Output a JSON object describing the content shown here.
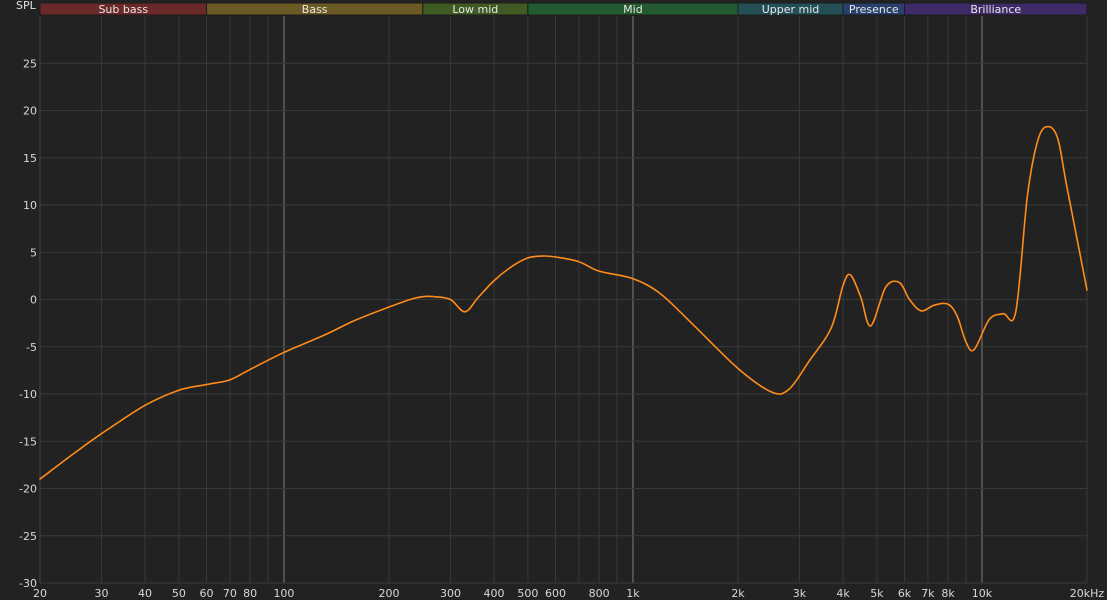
{
  "chart_data": {
    "type": "line",
    "ylabel": "SPL",
    "x_scale": "log",
    "xlim": [
      20,
      20000
    ],
    "ylim": [
      -30,
      30
    ],
    "grid": true,
    "x_ticks": [
      {
        "value": 20,
        "label": "20"
      },
      {
        "value": 30,
        "label": "30"
      },
      {
        "value": 40,
        "label": "40"
      },
      {
        "value": 50,
        "label": "50"
      },
      {
        "value": 60,
        "label": "60"
      },
      {
        "value": 70,
        "label": "70"
      },
      {
        "value": 80,
        "label": "80"
      },
      {
        "value": 100,
        "label": "100"
      },
      {
        "value": 200,
        "label": "200"
      },
      {
        "value": 300,
        "label": "300"
      },
      {
        "value": 400,
        "label": "400"
      },
      {
        "value": 500,
        "label": "500"
      },
      {
        "value": 600,
        "label": "600"
      },
      {
        "value": 800,
        "label": "800"
      },
      {
        "value": 1000,
        "label": "1k"
      },
      {
        "value": 2000,
        "label": "2k"
      },
      {
        "value": 3000,
        "label": "3k"
      },
      {
        "value": 4000,
        "label": "4k"
      },
      {
        "value": 5000,
        "label": "5k"
      },
      {
        "value": 6000,
        "label": "6k"
      },
      {
        "value": 7000,
        "label": "7k"
      },
      {
        "value": 8000,
        "label": "8k"
      },
      {
        "value": 10000,
        "label": "10k"
      },
      {
        "value": 20000,
        "label": "20kHz"
      }
    ],
    "y_ticks": [
      {
        "value": 25,
        "label": "25"
      },
      {
        "value": 20,
        "label": "20"
      },
      {
        "value": 15,
        "label": "15"
      },
      {
        "value": 10,
        "label": "10"
      },
      {
        "value": 5,
        "label": "5"
      },
      {
        "value": 0,
        "label": "0"
      },
      {
        "value": -5,
        "label": "-5"
      },
      {
        "value": -10,
        "label": "-10"
      },
      {
        "value": -15,
        "label": "-15"
      },
      {
        "value": -20,
        "label": "-20"
      },
      {
        "value": -25,
        "label": "-25"
      },
      {
        "value": -30,
        "label": "-30"
      }
    ],
    "bands": [
      {
        "label": "Sub bass",
        "from": 20,
        "to": 60,
        "color": "#6b2828"
      },
      {
        "label": "Bass",
        "from": 60,
        "to": 250,
        "color": "#6b5a24"
      },
      {
        "label": "Low mid",
        "from": 250,
        "to": 500,
        "color": "#3f5a22"
      },
      {
        "label": "Mid",
        "from": 500,
        "to": 2000,
        "color": "#245a30"
      },
      {
        "label": "Upper mid",
        "from": 2000,
        "to": 4000,
        "color": "#234f56"
      },
      {
        "label": "Presence",
        "from": 4000,
        "to": 6000,
        "color": "#28406b"
      },
      {
        "label": "Brilliance",
        "from": 6000,
        "to": 20000,
        "color": "#3d2a66"
      }
    ],
    "series": [
      {
        "color": "#ff8c1a",
        "x": [
          20,
          25,
          30,
          40,
          50,
          60,
          70,
          80,
          100,
          130,
          160,
          200,
          230,
          250,
          270,
          300,
          330,
          360,
          400,
          450,
          500,
          550,
          600,
          700,
          800,
          1000,
          1200,
          1500,
          2000,
          2500,
          2800,
          3200,
          3700,
          4000,
          4200,
          4500,
          4800,
          5300,
          5800,
          6200,
          6700,
          7300,
          8000,
          8500,
          9000,
          9500,
          10500,
          11500,
          12500,
          13500,
          14500,
          15500,
          16500,
          17500,
          20000
        ],
        "y": [
          -19,
          -16.3,
          -14.2,
          -11.2,
          -9.6,
          -9.0,
          -8.5,
          -7.4,
          -5.6,
          -3.8,
          -2.2,
          -0.8,
          0.0,
          0.3,
          0.3,
          0.0,
          -1.3,
          0.2,
          2.0,
          3.5,
          4.4,
          4.6,
          4.5,
          4.0,
          3.0,
          2.2,
          0.6,
          -2.8,
          -7.3,
          -9.8,
          -9.5,
          -6.5,
          -3.0,
          1.5,
          2.6,
          0.2,
          -2.8,
          1.3,
          1.8,
          0.0,
          -1.2,
          -0.6,
          -0.5,
          -1.8,
          -4.5,
          -5.3,
          -2.1,
          -1.5,
          -1.3,
          11.0,
          17.0,
          18.3,
          17.0,
          12.0,
          1.0
        ]
      }
    ]
  }
}
